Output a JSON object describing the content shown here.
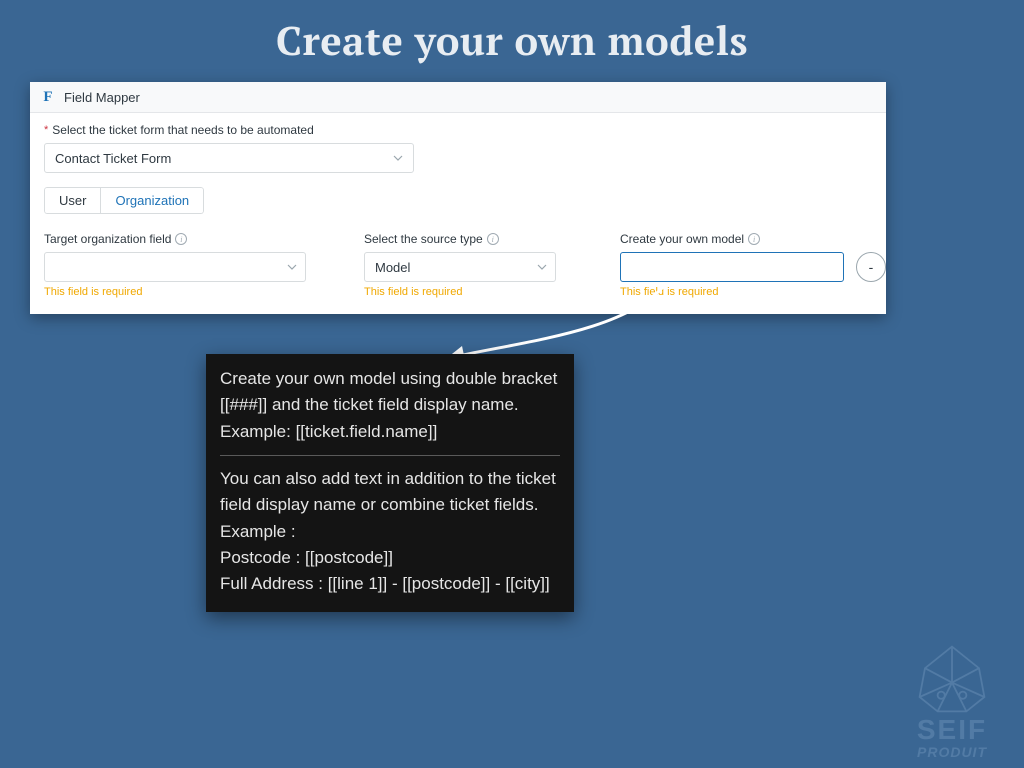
{
  "page": {
    "heading": "Create your own models"
  },
  "panel": {
    "app_icon_letter": "F",
    "title": "Field Mapper",
    "form_select": {
      "label": "Select the ticket form that needs to be automated",
      "value": "Contact Ticket Form"
    },
    "tabs": {
      "user": "User",
      "organization": "Organization",
      "active": "organization"
    },
    "columns": {
      "target": {
        "label": "Target organization field",
        "value": "",
        "error": "This field is required"
      },
      "source": {
        "label": "Select the source type",
        "value": "Model",
        "error": "This field is required"
      },
      "model": {
        "label": "Create your own model",
        "value": "",
        "error": "This field is required",
        "add_button_label": "-"
      }
    }
  },
  "tooltip": {
    "p1": "Create your own model using double bracket [[###]] and the ticket field display name.",
    "p1_ex": "Example: [[ticket.field.name]]",
    "p2": "You can also add text in addition to the ticket field display name or combine ticket fields.",
    "p2_ex_label": "Example :",
    "p2_ex_l1": "Postcode : [[postcode]]",
    "p2_ex_l2": "Full Address : [[line 1]] - [[postcode]] - [[city]]"
  },
  "brand": {
    "line1": "SEIF",
    "line2": "PRODUIT"
  }
}
